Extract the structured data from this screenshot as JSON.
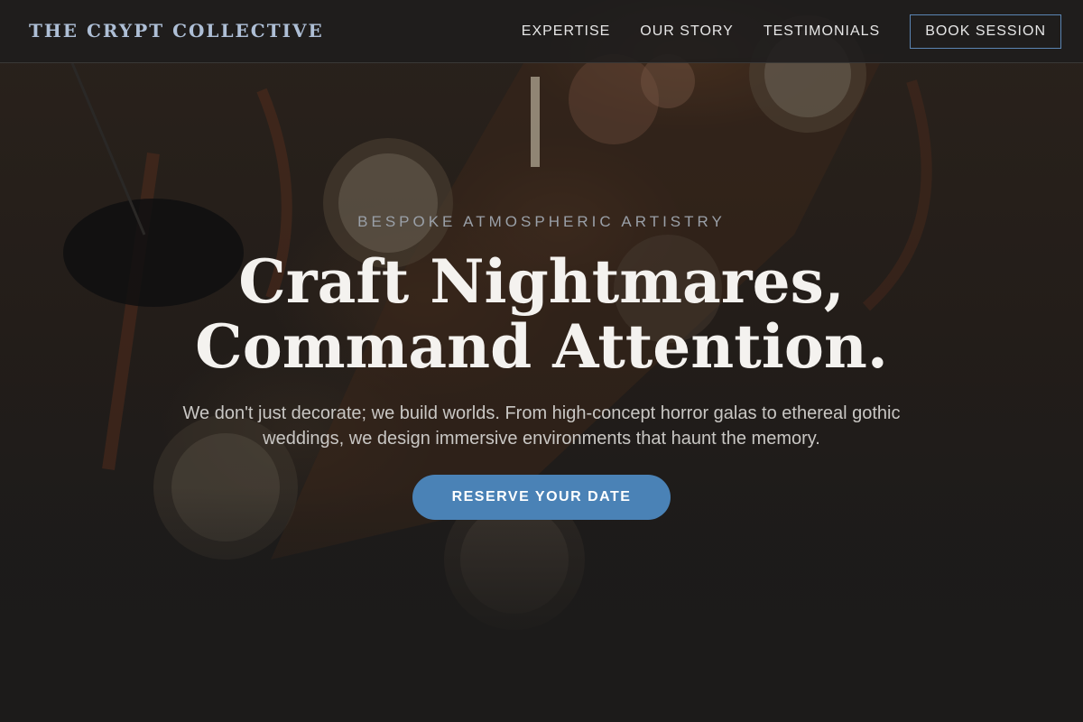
{
  "brand": {
    "name": "THE CRYPT COLLECTIVE"
  },
  "nav": {
    "items": [
      {
        "label": "EXPERTISE"
      },
      {
        "label": "OUR STORY"
      },
      {
        "label": "TESTIMONIALS"
      }
    ],
    "cta_label": "BOOK SESSION"
  },
  "hero": {
    "eyebrow": "BESPOKE ATMOSPHERIC ARTISTRY",
    "headline_line1": "Craft Nightmares,",
    "headline_line2": "Command Attention.",
    "subtext": "We don't just decorate; we build worlds. From high-concept horror galas to ethereal gothic weddings, we design immersive environments that haunt the memory.",
    "cta_label": "RESERVE YOUR DATE",
    "background_image": "candlelit-table-photo"
  },
  "colors": {
    "accent": "#4a82b6",
    "logo": "#aebfd6",
    "background": "#1c1b1a"
  }
}
